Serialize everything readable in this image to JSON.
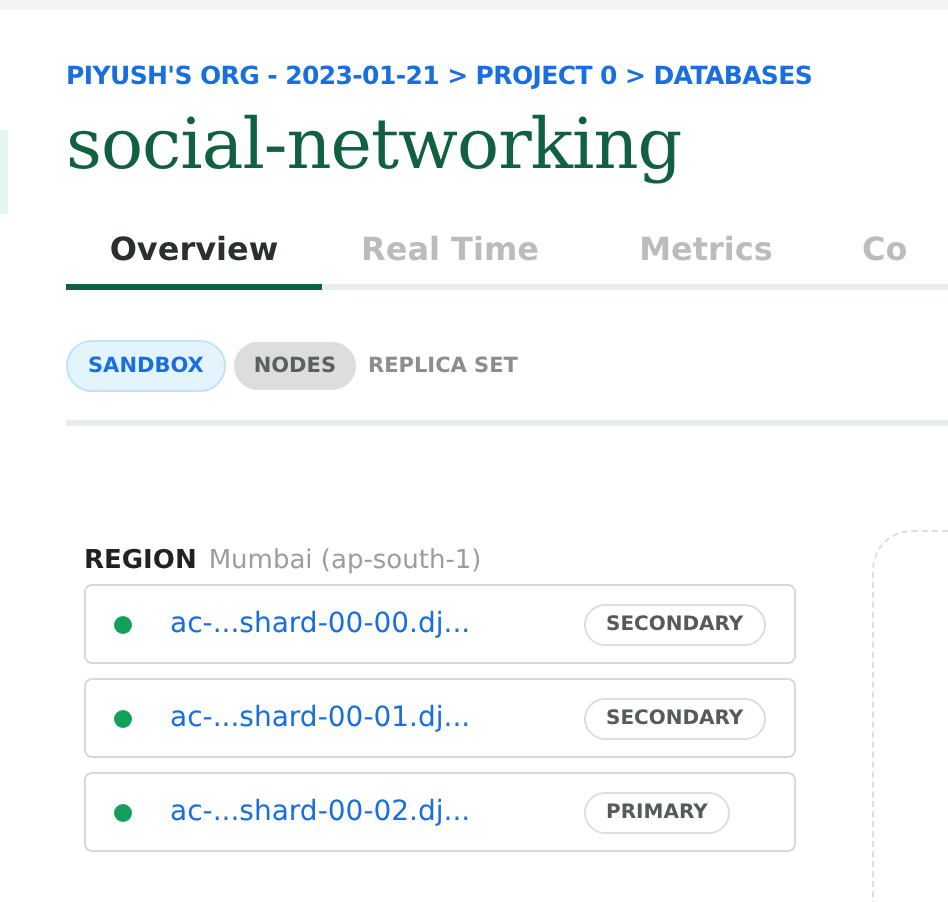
{
  "breadcrumb": "PIYUSH'S ORG - 2023-01-21 > PROJECT 0 > DATABASES",
  "title": "social-networking",
  "tabs": [
    {
      "label": "Overview",
      "selected": true
    },
    {
      "label": "Real Time",
      "selected": false
    },
    {
      "label": "Metrics",
      "selected": false
    },
    {
      "label": "Co",
      "selected": false
    }
  ],
  "tags": [
    {
      "label": "SANDBOX",
      "kind": "info"
    },
    {
      "label": "NODES",
      "kind": "neutral"
    },
    {
      "label": "REPLICA SET",
      "kind": "plain"
    }
  ],
  "region": {
    "label": "REGION",
    "value": "Mumbai (ap-south-1)"
  },
  "nodes": [
    {
      "host": "ac-...shard-00-00.dj...",
      "role": "SECONDARY",
      "color": "#13a05a"
    },
    {
      "host": "ac-...shard-00-01.dj...",
      "role": "SECONDARY",
      "color": "#13a05a"
    },
    {
      "host": "ac-...shard-00-02.dj...",
      "role": "PRIMARY",
      "color": "#13a05a"
    }
  ]
}
